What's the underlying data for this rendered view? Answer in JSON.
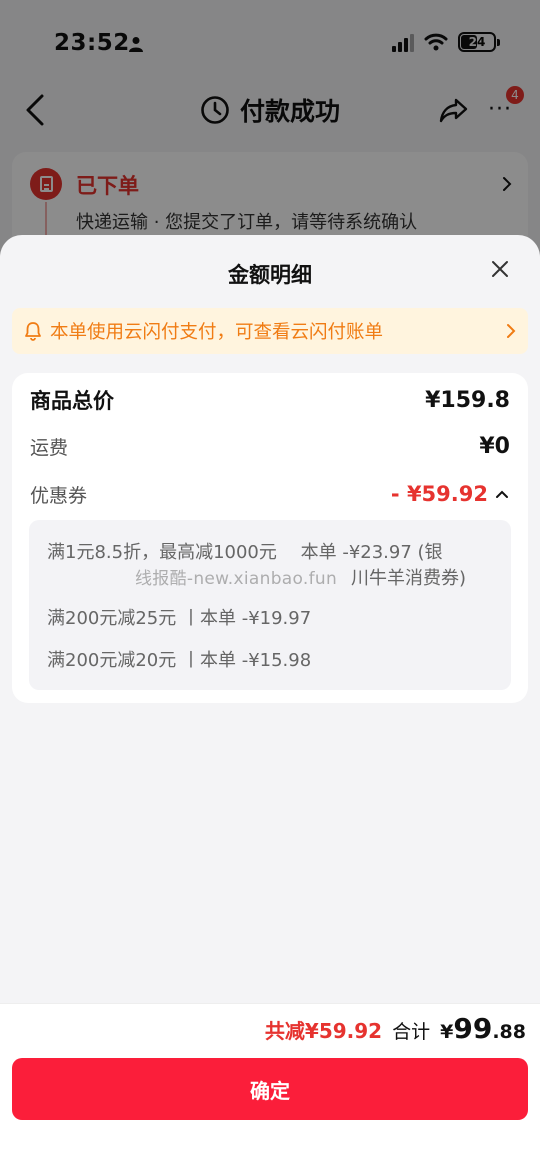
{
  "status_bar": {
    "time": "23:52",
    "battery": "24"
  },
  "nav": {
    "title": "付款成功",
    "badge": "4",
    "more": "···"
  },
  "order": {
    "title": "已下单",
    "desc": "快递运输 · 您提交了订单，请等待系统确认"
  },
  "sheet": {
    "title": "金额明细",
    "notice": "本单使用云闪付支付，可查看云闪付账单",
    "rows": {
      "total_label": "商品总价",
      "total_value": "¥159.8",
      "shipping_label": "运费",
      "shipping_value": "¥0",
      "coupon_label": "优惠券",
      "coupon_value": "- ¥59.92"
    },
    "coupons": {
      "line1a": "满1元8.5折，最高减1000元　 本单 -¥23.97 (银",
      "line1b": "川牛羊消费券)",
      "line2": "满200元减25元 丨本单 -¥19.97",
      "line3": "满200元减20元 丨本单 -¥15.98"
    },
    "watermark": "线报酷-new.xianbao.fun"
  },
  "footer": {
    "saved": "共减¥59.92",
    "total_label": "合计",
    "total_yen": "¥",
    "total_int": "99",
    "total_dec": ".88",
    "confirm": "确定"
  },
  "colors": {
    "accent_red": "#e6332f",
    "button_red": "#fb1e3a",
    "notice_orange": "#f07c14",
    "notice_bg": "#fff4de"
  }
}
